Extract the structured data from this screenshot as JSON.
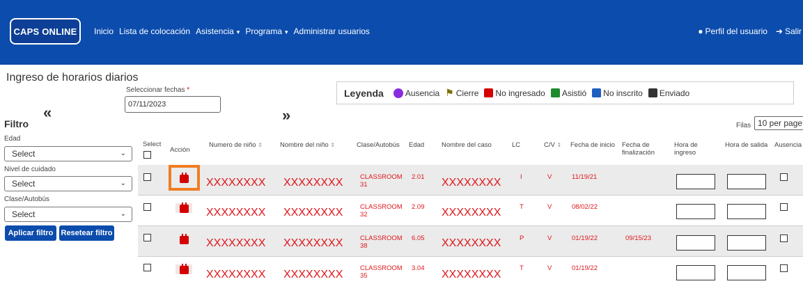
{
  "nav": {
    "logo": "CAPS ONLINE",
    "links": [
      "Inicio",
      "Lista de colocación",
      "Asistencia",
      "Programa",
      "Administrar usuarios"
    ],
    "caret": "▾",
    "profile": "Perfil del usuario",
    "logout": "Salir"
  },
  "page": {
    "title": "Ingreso de horarios diarios"
  },
  "dates": {
    "prev": "«",
    "next": "»",
    "label": "Seleccionar fechas",
    "required_mark": "*",
    "value": "07/11/2023"
  },
  "legend": {
    "title": "Leyenda",
    "items": [
      {
        "label": "Ausencia",
        "icon": "absence-icon",
        "color": "#8a2be2"
      },
      {
        "label": "Cierre",
        "icon": "flag-icon",
        "color": "#7d7000"
      },
      {
        "label": "No ingresado",
        "icon": "calendar-red-icon",
        "color": "#d40000"
      },
      {
        "label": "Asistió",
        "icon": "calendar-green-icon",
        "color": "#1f8a2e"
      },
      {
        "label": "No inscrito",
        "icon": "calendar-x-icon",
        "color": "#1e5fbf"
      },
      {
        "label": "Enviado",
        "icon": "calendar-check-icon",
        "color": "#333333"
      }
    ]
  },
  "filter": {
    "title": "Filtro",
    "age_label": "Edad",
    "age_value": "Select",
    "care_label": "Nivel de cuidado",
    "care_value": "Select",
    "class_label": "Clase/Autobús",
    "class_value": "Select",
    "apply": "Aplicar filtro",
    "reset": "Resetear filtro"
  },
  "rows_control": {
    "label": "Filas",
    "value": "10 per page"
  },
  "table": {
    "headers": {
      "select": "Select",
      "action": "Acción",
      "child_number": "Numero de niño",
      "child_name": "Nombre del niño",
      "class_bus": "Clase/Autobús",
      "age": "Edad",
      "case_name": "Nombre del caso",
      "lc": "LC",
      "cv": "C/V",
      "start_date": "Fecha de inicio",
      "end_date": "Fecha de finalización",
      "time_in": "Hora de ingreso",
      "time_out": "Hora de salida",
      "absence": "Ausencia"
    },
    "sort_icon": "⇕",
    "rows": [
      {
        "child_number": "XXXXXXXX",
        "child_name": "XXXXXXXX",
        "class_line1": "CLASSROOM",
        "class_line2": "31",
        "age": "2.01",
        "case_name": "XXXXXXXX",
        "lc": "I",
        "cv": "V",
        "start": "11/19/21",
        "end": ""
      },
      {
        "child_number": "XXXXXXXX",
        "child_name": "XXXXXXXX",
        "class_line1": "CLASSROOM",
        "class_line2": "32",
        "age": "2.09",
        "case_name": "XXXXXXXX",
        "lc": "T",
        "cv": "V",
        "start": "08/02/22",
        "end": ""
      },
      {
        "child_number": "XXXXXXXX",
        "child_name": "XXXXXXXX",
        "class_line1": "CLASSROOM",
        "class_line2": "38",
        "age": "6.05",
        "case_name": "XXXXXXXX",
        "lc": "P",
        "cv": "V",
        "start": "01/19/22",
        "end": "09/15/23"
      },
      {
        "child_number": "XXXXXXXX",
        "child_name": "XXXXXXXX",
        "class_line1": "CLASSROOM",
        "class_line2": "35",
        "age": "3.04",
        "case_name": "XXXXXXXX",
        "lc": "T",
        "cv": "V",
        "start": "01/19/22",
        "end": ""
      }
    ]
  }
}
